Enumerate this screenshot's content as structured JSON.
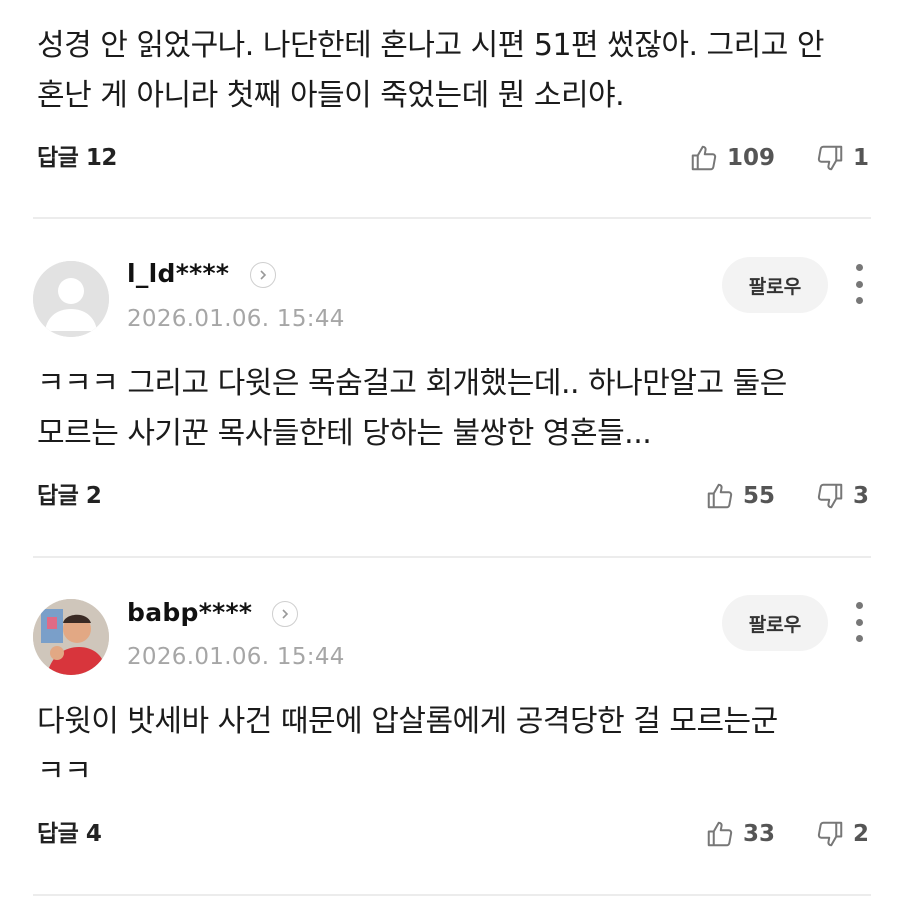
{
  "comments": [
    {
      "text": "성경 안 읽었구나. 나단한테 혼나고 시편 51편 썼잖아. 그리고 안 혼난 게 아니라 첫째 아들이 죽었는데 뭔 소리야.",
      "reply_label": "답글 12",
      "likes": "109",
      "dislikes": "1"
    },
    {
      "username": "l_ld****",
      "date": "2026.01.06. 15:44",
      "follow_label": "팔로우",
      "text": "ㅋㅋㅋ 그리고 다윗은 목숨걸고 회개했는데.. 하나만알고 둘은 모르는 사기꾼 목사들한테 당하는 불쌍한 영혼들...",
      "reply_label": "답글 2",
      "likes": "55",
      "dislikes": "3"
    },
    {
      "username": "babp****",
      "date": "2026.01.06. 15:44",
      "follow_label": "팔로우",
      "text": "다윗이 밧세바 사건 때문에 압살롬에게 공격당한 걸 모르는군 ㅋㅋ",
      "reply_label": "답글 4",
      "likes": "33",
      "dislikes": "2"
    }
  ],
  "icons": {
    "like": "thumbs-up-icon",
    "dislike": "thumbs-down-icon",
    "profile_chevron": "chevron-right-icon",
    "more": "more-vertical-icon",
    "default_avatar": "default-avatar-icon"
  },
  "colors": {
    "date": "#a6a6a6",
    "divider": "#ececec",
    "follow_bg": "#f3f3f3"
  }
}
